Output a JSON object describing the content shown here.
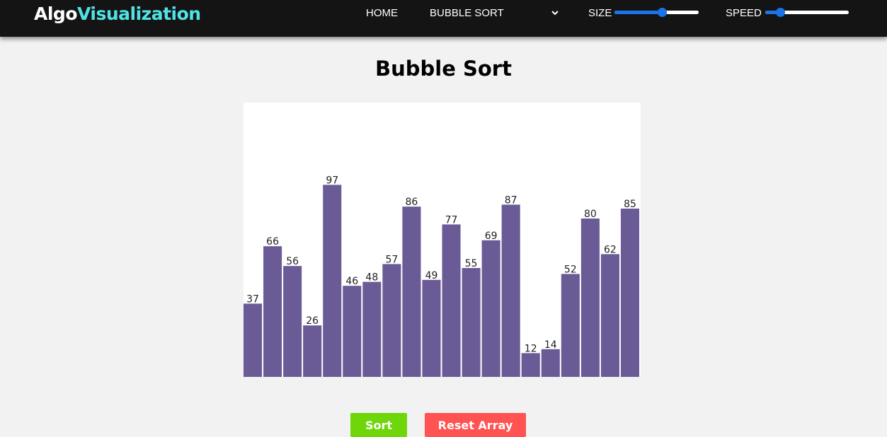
{
  "navbar": {
    "brand_part1": "Algo",
    "brand_part2": "Visualization",
    "home_label": "HOME",
    "algorithm_selected": "BUBBLE SORT",
    "size_label": "SIZE",
    "speed_label": "SPEED",
    "size_level": 0.57,
    "speed_level": 0.18,
    "brand_accent_color": "#4fe3e6",
    "slider_color": "#1a73e8"
  },
  "main": {
    "title": "Bubble Sort"
  },
  "buttons": {
    "sort_label": "Sort",
    "reset_label": "Reset Array",
    "sort_color": "#6fd60a",
    "reset_color": "#ff5252"
  },
  "chart_data": {
    "type": "bar",
    "values": [
      37,
      66,
      56,
      26,
      97,
      46,
      48,
      57,
      86,
      49,
      77,
      55,
      69,
      87,
      12,
      14,
      52,
      80,
      62,
      85
    ],
    "ylim": [
      0,
      100
    ],
    "bar_color": "#6a5b96",
    "data_labels": true
  }
}
